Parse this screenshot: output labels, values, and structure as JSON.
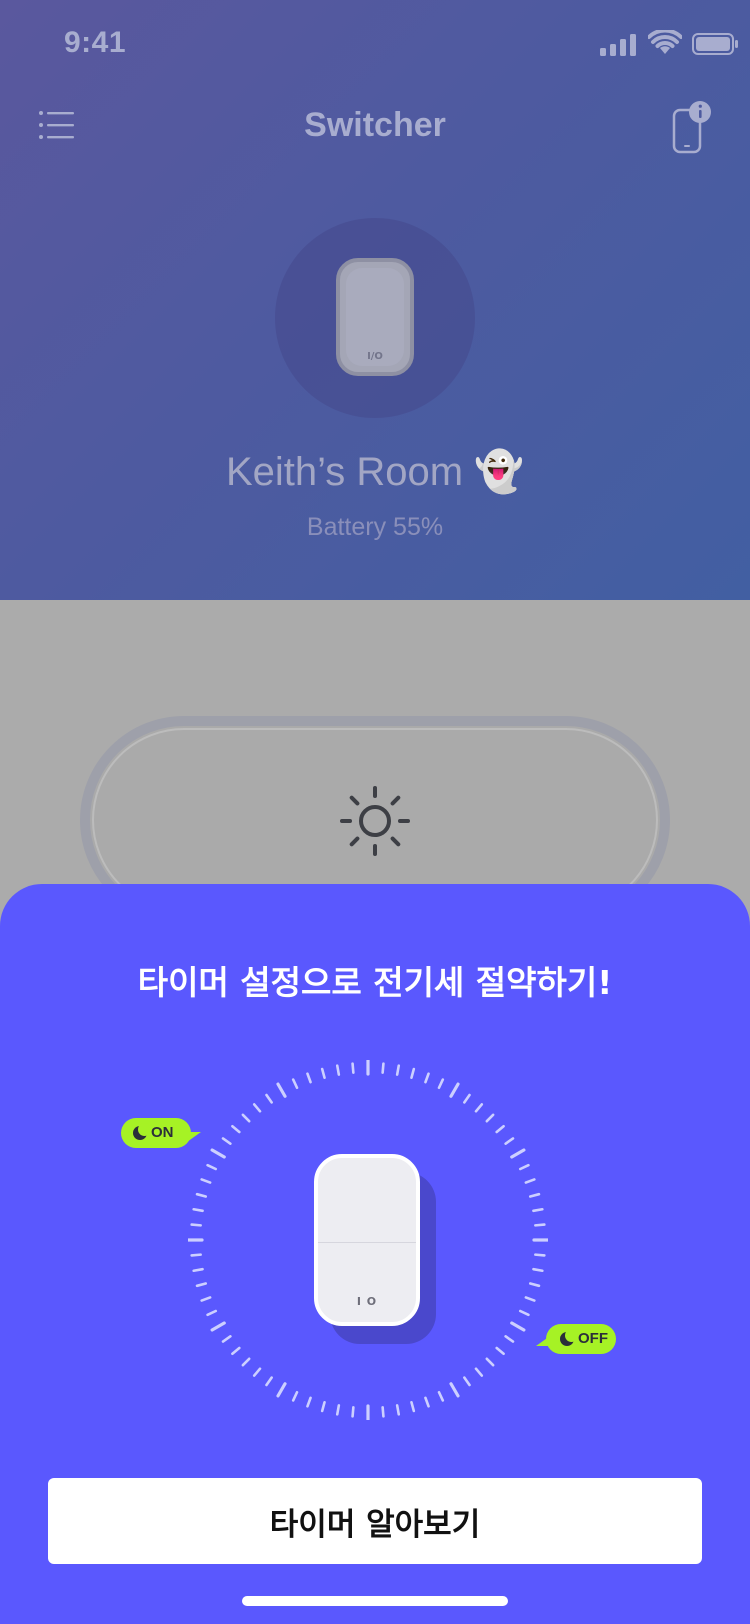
{
  "status_bar": {
    "time": "9:41",
    "icons": [
      "signal-icon",
      "wifi-icon",
      "battery-icon"
    ]
  },
  "nav": {
    "title": "Switcher",
    "left_icon": "menu-icon",
    "right_icon": "device-info-icon"
  },
  "device": {
    "switch_label": "I/O",
    "room_name": "Keith’s Room 👻",
    "battery_text": "Battery 55%",
    "battery_percent": 55
  },
  "toggle": {
    "icon": "sun-icon"
  },
  "sheet": {
    "title": "타이머 설정으로 전기세 절약하기!",
    "on_tag": "ON",
    "off_tag": "OFF",
    "device_label": "I O",
    "cta_label": "타이머 알아보기"
  },
  "colors": {
    "sheet_bg": "#5A58FE",
    "tag_green": "#A6F225",
    "header_gradient_start": "#5A589E",
    "header_gradient_end": "#425FA2"
  }
}
